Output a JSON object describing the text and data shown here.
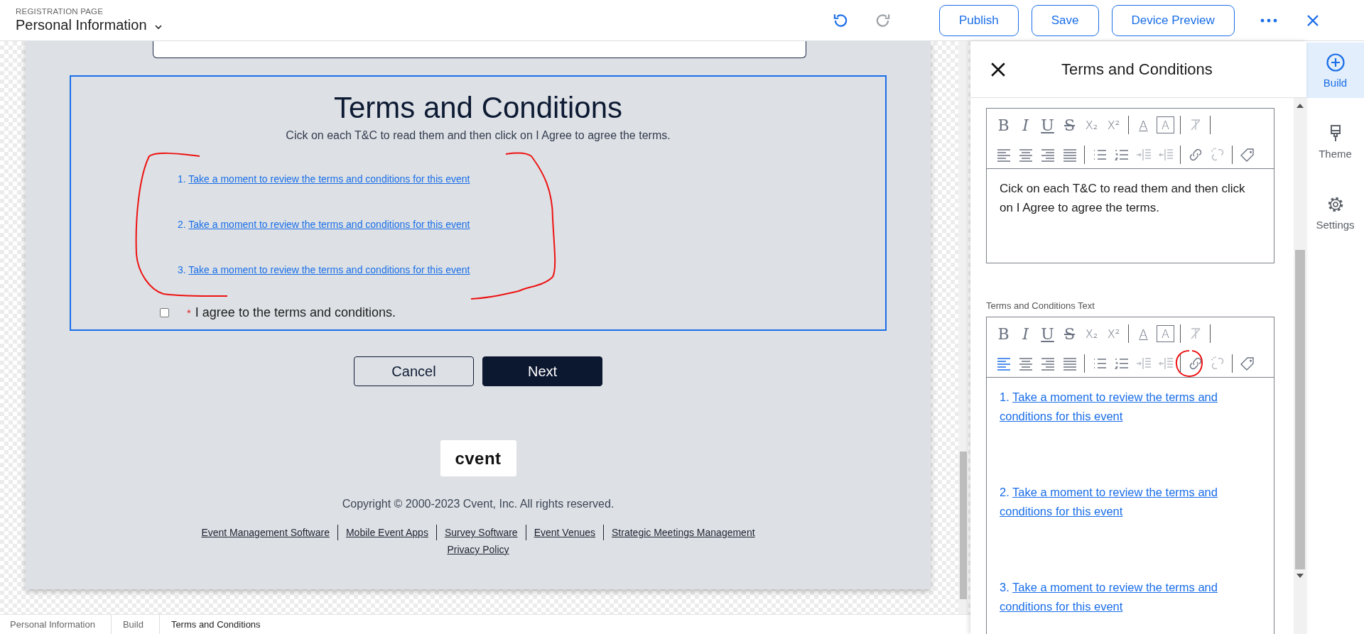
{
  "header": {
    "eyebrow": "REGISTRATION PAGE",
    "page_name": "Personal Information",
    "history": [
      {
        "kind": "undo",
        "disabled": false
      },
      {
        "kind": "redo",
        "disabled": true
      }
    ],
    "actions": [
      "Publish",
      "Save",
      "Device Preview"
    ]
  },
  "canvas": {
    "terms": {
      "title": "Terms and Conditions",
      "instructions": "Cick on each T&C to read them and then click on I Agree to agree the terms.",
      "links": [
        {
          "number": "1.",
          "text": "Take a moment to review the terms and conditions for this event"
        },
        {
          "number": "2.",
          "text": "Take a moment to review the terms and conditions for this event"
        },
        {
          "number": "3.",
          "text": "Take a moment to review the terms and conditions for this event"
        }
      ],
      "agree": {
        "required_mark": "*",
        "label": "I agree to the terms and conditions.",
        "checked": false
      }
    },
    "buttons": [
      {
        "label": "Cancel",
        "kind": "secondary"
      },
      {
        "label": "Next",
        "kind": "primary"
      }
    ],
    "footer": {
      "logo": "cvent",
      "copyright": "Copyright © 2000-2023 Cvent, Inc. All rights reserved.",
      "links": [
        "Event Management Software",
        "Mobile Event Apps",
        "Survey Software",
        "Event Venues",
        "Strategic Meetings Management"
      ],
      "privacy": "Privacy Policy"
    }
  },
  "breadcrumbs": [
    "Personal Information",
    "Build",
    "Terms and Conditions"
  ],
  "panel": {
    "title": "Terms and Conditions",
    "editors": [
      {
        "toolbar_rows": [
          [
            {
              "kind": "bold",
              "glyph": "B",
              "active": false,
              "disabled": false
            },
            {
              "kind": "italic",
              "glyph": "I",
              "active": false,
              "disabled": false
            },
            {
              "kind": "underline",
              "glyph": "U",
              "active": false,
              "disabled": false
            },
            {
              "kind": "strike",
              "glyph": "S",
              "active": false,
              "disabled": false
            },
            {
              "kind": "subscript",
              "glyph": "X₂",
              "active": false,
              "disabled": false
            },
            {
              "kind": "superscript",
              "glyph": "X²",
              "active": false,
              "disabled": false
            },
            {
              "kind": "separator"
            },
            {
              "kind": "font-color",
              "glyph": "A",
              "active": false,
              "disabled": false
            },
            {
              "kind": "highlight",
              "glyph": "A",
              "active": false,
              "disabled": false
            },
            {
              "kind": "separator"
            },
            {
              "kind": "clear-format",
              "active": false,
              "disabled": true
            },
            {
              "kind": "separator"
            }
          ],
          [
            {
              "kind": "align-left",
              "active": false,
              "disabled": false
            },
            {
              "kind": "align-center",
              "active": false,
              "disabled": false
            },
            {
              "kind": "align-right",
              "active": false,
              "disabled": false
            },
            {
              "kind": "justify",
              "active": false,
              "disabled": false
            },
            {
              "kind": "separator"
            },
            {
              "kind": "bullet-list",
              "active": false,
              "disabled": false
            },
            {
              "kind": "numbered-list",
              "active": false,
              "disabled": false
            },
            {
              "kind": "indent",
              "active": false,
              "disabled": true
            },
            {
              "kind": "outdent",
              "active": false,
              "disabled": true
            },
            {
              "kind": "separator"
            },
            {
              "kind": "link",
              "active": false,
              "disabled": false
            },
            {
              "kind": "unlink",
              "active": false,
              "disabled": true
            },
            {
              "kind": "separator"
            },
            {
              "kind": "tag",
              "active": false,
              "disabled": false
            }
          ]
        ],
        "text": "Cick on each T&C to read them and then click on I Agree to agree the terms."
      },
      {
        "label": "Terms and Conditions Text",
        "toolbar_rows": [
          [
            {
              "kind": "bold",
              "glyph": "B",
              "active": false,
              "disabled": false
            },
            {
              "kind": "italic",
              "glyph": "I",
              "active": false,
              "disabled": false
            },
            {
              "kind": "underline",
              "glyph": "U",
              "active": false,
              "disabled": false
            },
            {
              "kind": "strike",
              "glyph": "S",
              "active": false,
              "disabled": false
            },
            {
              "kind": "subscript",
              "glyph": "X₂",
              "active": false,
              "disabled": false
            },
            {
              "kind": "superscript",
              "glyph": "X²",
              "active": false,
              "disabled": false
            },
            {
              "kind": "separator"
            },
            {
              "kind": "font-color",
              "glyph": "A",
              "active": false,
              "disabled": false
            },
            {
              "kind": "highlight",
              "glyph": "A",
              "active": false,
              "disabled": false
            },
            {
              "kind": "separator"
            },
            {
              "kind": "clear-format",
              "active": false,
              "disabled": true
            },
            {
              "kind": "separator"
            }
          ],
          [
            {
              "kind": "align-left",
              "active": true,
              "disabled": false
            },
            {
              "kind": "align-center",
              "active": false,
              "disabled": false
            },
            {
              "kind": "align-right",
              "active": false,
              "disabled": false
            },
            {
              "kind": "justify",
              "active": false,
              "disabled": false
            },
            {
              "kind": "separator"
            },
            {
              "kind": "bullet-list",
              "active": false,
              "disabled": false
            },
            {
              "kind": "numbered-list",
              "active": false,
              "disabled": false
            },
            {
              "kind": "indent",
              "active": false,
              "disabled": true
            },
            {
              "kind": "outdent",
              "active": false,
              "disabled": true
            },
            {
              "kind": "separator"
            },
            {
              "kind": "link",
              "active": false,
              "disabled": false
            },
            {
              "kind": "unlink",
              "active": false,
              "disabled": true
            },
            {
              "kind": "separator"
            },
            {
              "kind": "tag",
              "active": false,
              "disabled": false
            }
          ]
        ],
        "links": [
          {
            "number": "1.",
            "text": "Take a moment to review the terms and conditions for this event"
          },
          {
            "number": "2.",
            "text": "Take a moment to review the terms and conditions for this event"
          },
          {
            "number": "3.",
            "text": "Take a moment to review the terms and conditions for this event"
          }
        ]
      }
    ]
  },
  "rail": [
    {
      "kind": "build",
      "label": "Build",
      "selected": true
    },
    {
      "kind": "theme",
      "label": "Theme",
      "selected": false
    },
    {
      "kind": "settings",
      "label": "Settings",
      "selected": false
    }
  ]
}
